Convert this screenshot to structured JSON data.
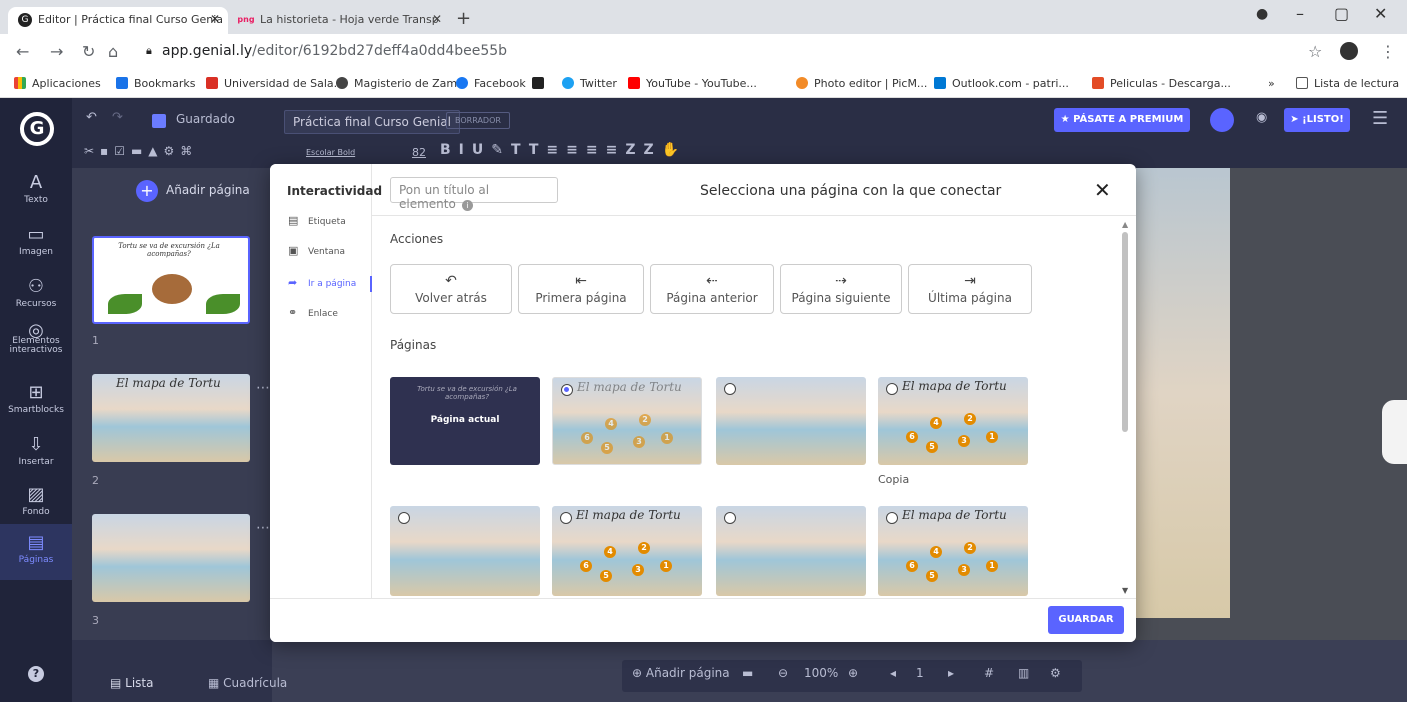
{
  "browser": {
    "tabs": [
      {
        "title": "Editor | Práctica final Curso Genia",
        "active": true
      },
      {
        "title": "La historieta - Hoja verde Transp",
        "favicon_text": "png",
        "active": false
      }
    ],
    "url_host": "app.genial.ly",
    "url_path": "/editor/6192bd27deff4a0dd4bee55b",
    "bookmarks": [
      "Aplicaciones",
      "Bookmarks",
      "Universidad de Sala...",
      "Magisterio de Zam...",
      "Facebook",
      "Twitter",
      "YouTube - YouTube...",
      "Photo editor | PicM...",
      "Outlook.com - patri...",
      "Peliculas - Descarga..."
    ],
    "reading_list": "Lista de lectura",
    "more_bookmarks": "»"
  },
  "editor": {
    "saved_label": "Guardado",
    "doc_title": "Práctica final Curso Genial",
    "draft_badge": "BORRADOR",
    "premium_label": "PÁSATE A PREMIUM",
    "ready_label": "¡LISTO!",
    "font_name": "Escolar Bold",
    "font_size": "82",
    "left_tools": [
      {
        "label": "Texto",
        "icon": "text-icon",
        "glyph": "A"
      },
      {
        "label": "Imagen",
        "icon": "image-icon",
        "glyph": "▭"
      },
      {
        "label": "Recursos",
        "icon": "resources-icon",
        "glyph": "⚇"
      },
      {
        "label": "Elementos interactivos",
        "icon": "interactive-icon",
        "glyph": "◎"
      },
      {
        "label": "Smartblocks",
        "icon": "smartblocks-icon",
        "glyph": "⊞"
      },
      {
        "label": "Insertar",
        "icon": "insert-icon",
        "glyph": "⇩"
      },
      {
        "label": "Fondo",
        "icon": "background-icon",
        "glyph": "▨"
      },
      {
        "label": "Páginas",
        "icon": "pages-icon",
        "glyph": "▤"
      }
    ],
    "add_page_label": "Añadir página",
    "page_numbers": [
      "1",
      "2",
      "3"
    ],
    "thumb1_text": "Tortu se va de excursión ¿La acompañas?",
    "thumb2_text": "El mapa de Tortu",
    "bottom": {
      "list_label": "Lista",
      "grid_label": "Cuadrícula",
      "add_page_label": "Añadir página",
      "zoom": "100%",
      "page_index": "1"
    }
  },
  "modal": {
    "sidebar_title": "Interactividad",
    "sidebar_items": [
      {
        "label": "Etiqueta",
        "icon": "label-icon",
        "glyph": "▤"
      },
      {
        "label": "Ventana",
        "icon": "window-icon",
        "glyph": "▣"
      },
      {
        "label": "Ir a página",
        "icon": "goto-page-icon",
        "glyph": "➦"
      },
      {
        "label": "Enlace",
        "icon": "link-icon",
        "glyph": "⚭"
      }
    ],
    "element_title_placeholder": "Pon un título al elemento",
    "title": "Selecciona una página con la que conectar",
    "actions_label": "Acciones",
    "actions": [
      {
        "label": "Volver atrás",
        "glyph": "↶"
      },
      {
        "label": "Primera página",
        "glyph": "⇤"
      },
      {
        "label": "Página anterior",
        "glyph": "⇠"
      },
      {
        "label": "Página siguiente",
        "glyph": "⇢"
      },
      {
        "label": "Última página",
        "glyph": "⇥"
      }
    ],
    "pages_label": "Páginas",
    "current_page_label": "Página actual",
    "current_page_text": "Tortu se va de excursión ¿La acompañas?",
    "map_title": "El mapa de Tortu",
    "copy_label": "Copia",
    "save_label": "GUARDAR"
  },
  "colors": {
    "accent": "#5a64ff",
    "sidebar": "#20243a",
    "topbar": "#2a2e45"
  }
}
